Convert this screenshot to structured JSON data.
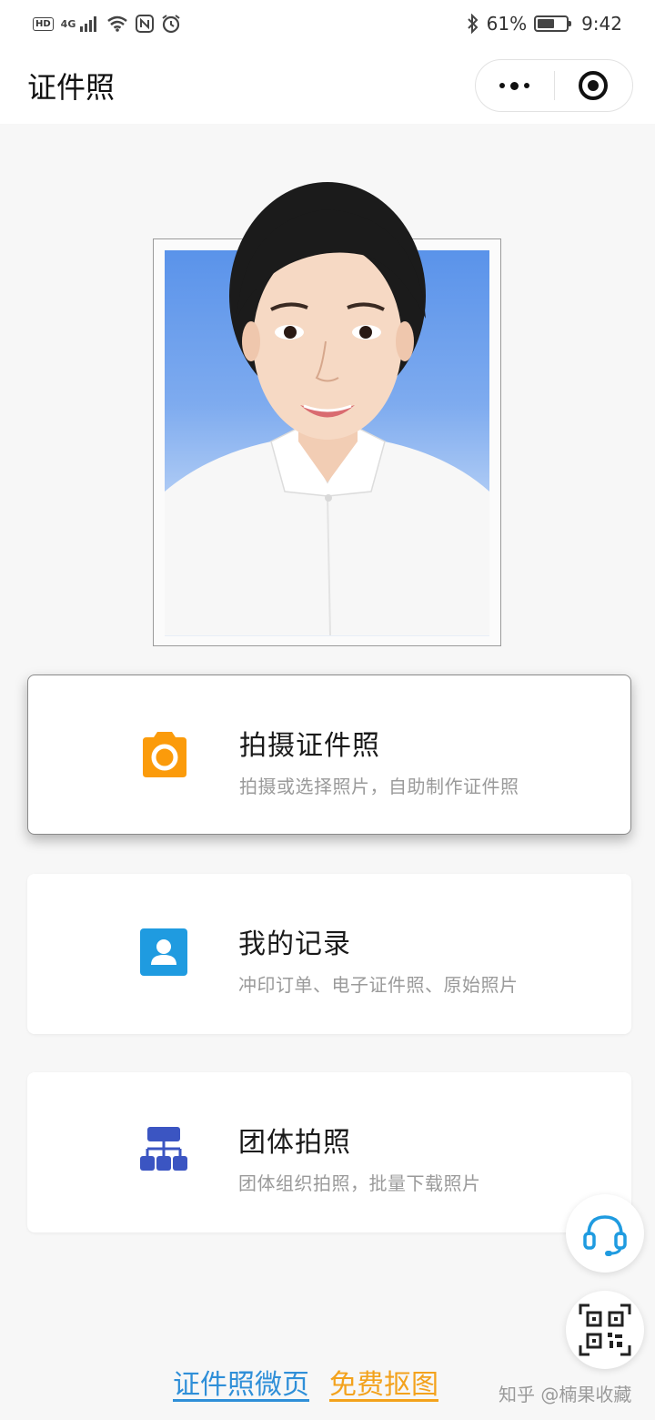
{
  "status_bar": {
    "left_badges": [
      "HD",
      "4G"
    ],
    "battery": "61%",
    "battery_level": 0.61,
    "time": "9:42",
    "icons": [
      "signal-icon",
      "wifi-icon",
      "nfc-icon",
      "alarm-icon",
      "bluetooth-icon",
      "battery-icon"
    ]
  },
  "nav": {
    "title": "证件照",
    "menu_icon": "more-dots-icon",
    "close_icon": "target-close-icon"
  },
  "cards": [
    {
      "title": "拍摄证件照",
      "subtitle": "拍摄或选择照片，自助制作证件照",
      "icon": "camera-icon",
      "color": "#fb9b0b"
    },
    {
      "title": "我的记录",
      "subtitle": "冲印订单、电子证件照、原始照片",
      "icon": "user-record-icon",
      "color": "#1f9be0"
    },
    {
      "title": "团体拍照",
      "subtitle": "团体组织拍照，批量下载照片",
      "icon": "org-chart-icon",
      "color": "#3b55c2"
    }
  ],
  "floating": {
    "support_icon": "headset-icon",
    "qr_icon": "qr-code-icon",
    "support_color": "#1f9be0"
  },
  "footer": {
    "link_blue": "证件照微页",
    "link_orange": "免费抠图",
    "watermark": "知乎 @楠果收藏",
    "blue": "#2f8fd8",
    "orange": "#f3a21c"
  }
}
